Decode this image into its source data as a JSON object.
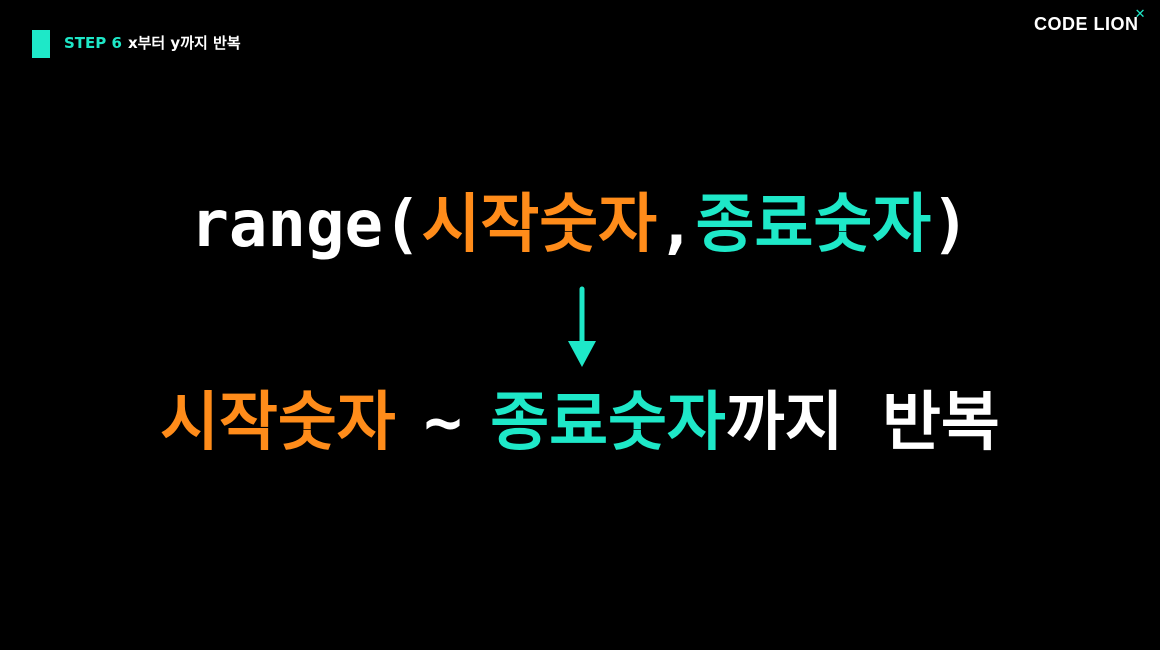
{
  "header": {
    "step": "STEP 6",
    "title": "x부터 y까지 반복"
  },
  "logo": {
    "text": "CODE LION"
  },
  "code": {
    "fn": "range(",
    "start": "시작숫자",
    "comma": ",",
    "end": "종료숫자",
    "close": ")"
  },
  "result": {
    "start": "시작숫자",
    "tilde": "~",
    "end": "종료숫자",
    "suffix": "까지 반복"
  },
  "colors": {
    "accent": "#1ee8c8",
    "orange": "#ff8c1a",
    "background": "#000000"
  },
  "icons": {
    "arrow": "arrow-down-icon"
  }
}
